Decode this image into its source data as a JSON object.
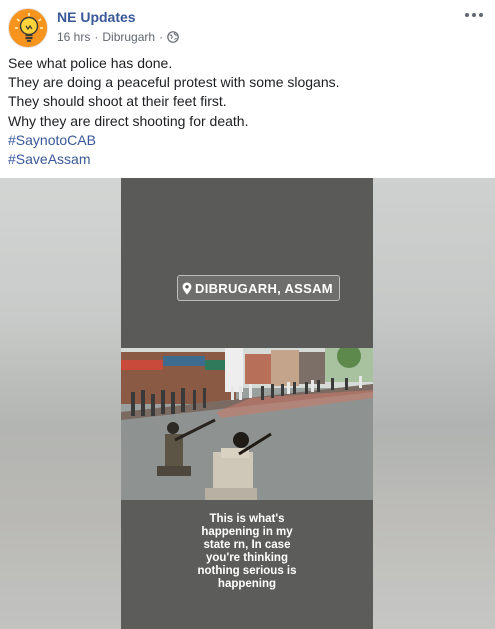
{
  "post": {
    "page_name": "NE Updates",
    "time": "16 hrs",
    "separator": "·",
    "location": "Dibrugarh",
    "lines": [
      "See what police has done.",
      "They are doing a peaceful protest with some slogans.",
      "They should shoot at their feet first.",
      "Why they are direct shooting for death."
    ],
    "hashtags": [
      "#SaynotoCAB",
      "#SaveAssam"
    ]
  },
  "media": {
    "location_sticker": "DIBRUGARH, ASSAM",
    "caption_lines": [
      "This is what's",
      "happening in my",
      "state rn, In case",
      "you're thinking",
      "nothing serious is",
      "happening"
    ]
  },
  "icons": {
    "avatar": "lightbulb-logo-icon",
    "audience": "globe-icon",
    "more": "more-options-icon",
    "location_pin": "map-pin-icon"
  },
  "colors": {
    "link": "#385898",
    "meta": "#616770",
    "avatar_bg": "#f7941d"
  }
}
